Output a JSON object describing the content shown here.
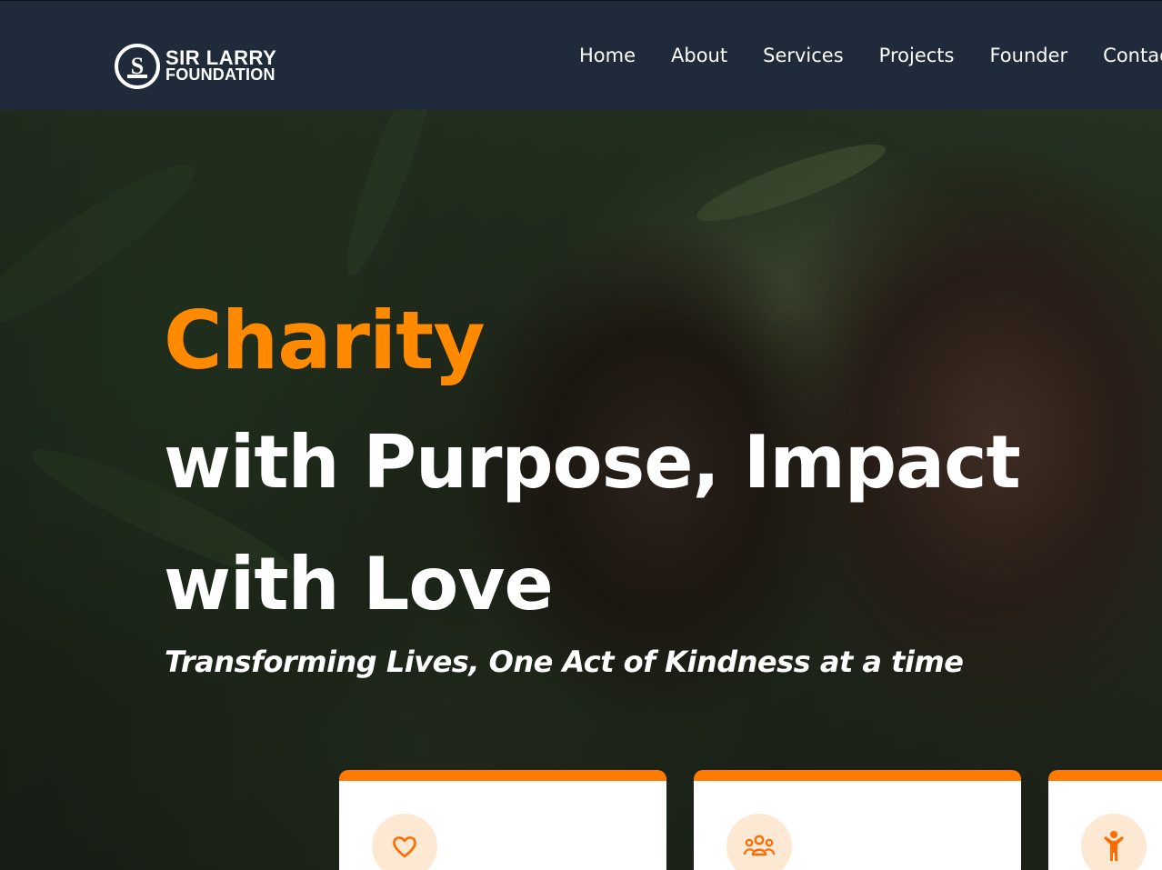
{
  "brand": {
    "logo_initials": "SLF",
    "name_line1": "SIR LARRY",
    "name_line2": "FOUNDATION"
  },
  "nav": {
    "items": [
      "Home",
      "About",
      "Services",
      "Projects",
      "Founder",
      "Contact"
    ]
  },
  "hero": {
    "headline_accent": "Charity",
    "headline_line2": "with Purpose, Impact",
    "headline_line3": "with Love",
    "tagline": "Transforming Lives, One Act of Kindness at a time"
  },
  "cards": [
    {
      "icon": "heart-icon"
    },
    {
      "icon": "people-group-icon"
    },
    {
      "icon": "child-icon"
    }
  ],
  "colors": {
    "header_bg": "#1f2a3a",
    "accent": "#ff8a00",
    "card_border": "#ff7b00",
    "icon_bg": "#fde8d3"
  }
}
